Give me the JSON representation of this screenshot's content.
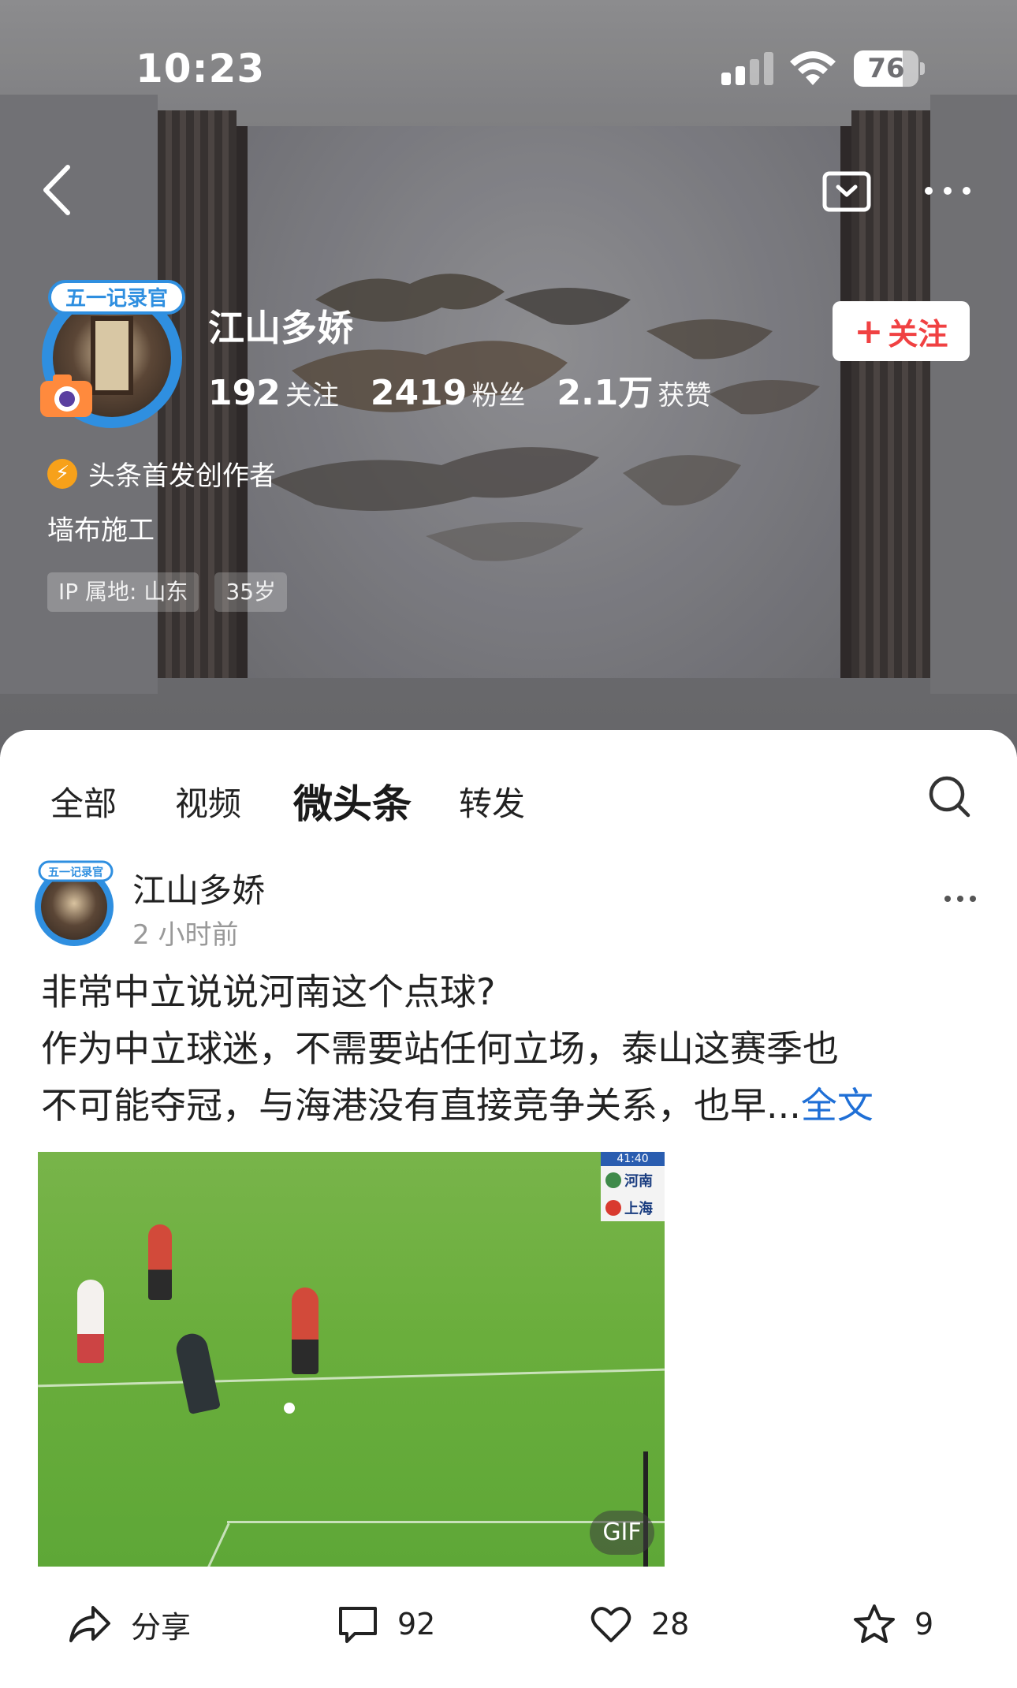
{
  "status_bar": {
    "time": "10:23",
    "battery_level": "76",
    "battery_fraction": 0.76
  },
  "profile": {
    "name": "江山多娇",
    "avatar_badge": "五一记录官",
    "stats": [
      {
        "value": "192",
        "label": "关注"
      },
      {
        "value": "2419",
        "label": "粉丝"
      },
      {
        "value": "2.1万",
        "label": "获赞"
      }
    ],
    "follow_label": "关注",
    "creator_label": "头条首发创作者",
    "bio": "墙布施工",
    "tags": [
      "IP 属地: 山东",
      "35岁"
    ]
  },
  "tabs": [
    {
      "label": "全部",
      "active": false
    },
    {
      "label": "视频",
      "active": false
    },
    {
      "label": "微头条",
      "active": true
    },
    {
      "label": "转发",
      "active": false
    }
  ],
  "post": {
    "author": "江山多娇",
    "time": "2 小时前",
    "text_lines": [
      "非常中立说说河南这个点球?",
      "作为中立球迷，不需要站任何立场，泰山这赛季也",
      "不可能夺冠，与海港没有直接竞争关系，也早..."
    ],
    "full_text_link": "全文",
    "image": {
      "scoreboard_time": "41:40",
      "scoreboard_team1": "河南",
      "scoreboard_team2": "上海",
      "gif_label": "GIF"
    },
    "actions": {
      "share_label": "分享",
      "comments": "92",
      "likes": "28",
      "favorites": "9"
    }
  },
  "colors": {
    "follow_red": "#f04142",
    "link_blue": "#1f6fd6",
    "avatar_ring": "#2f8fe0",
    "creator_icon": "#f7a11a"
  }
}
